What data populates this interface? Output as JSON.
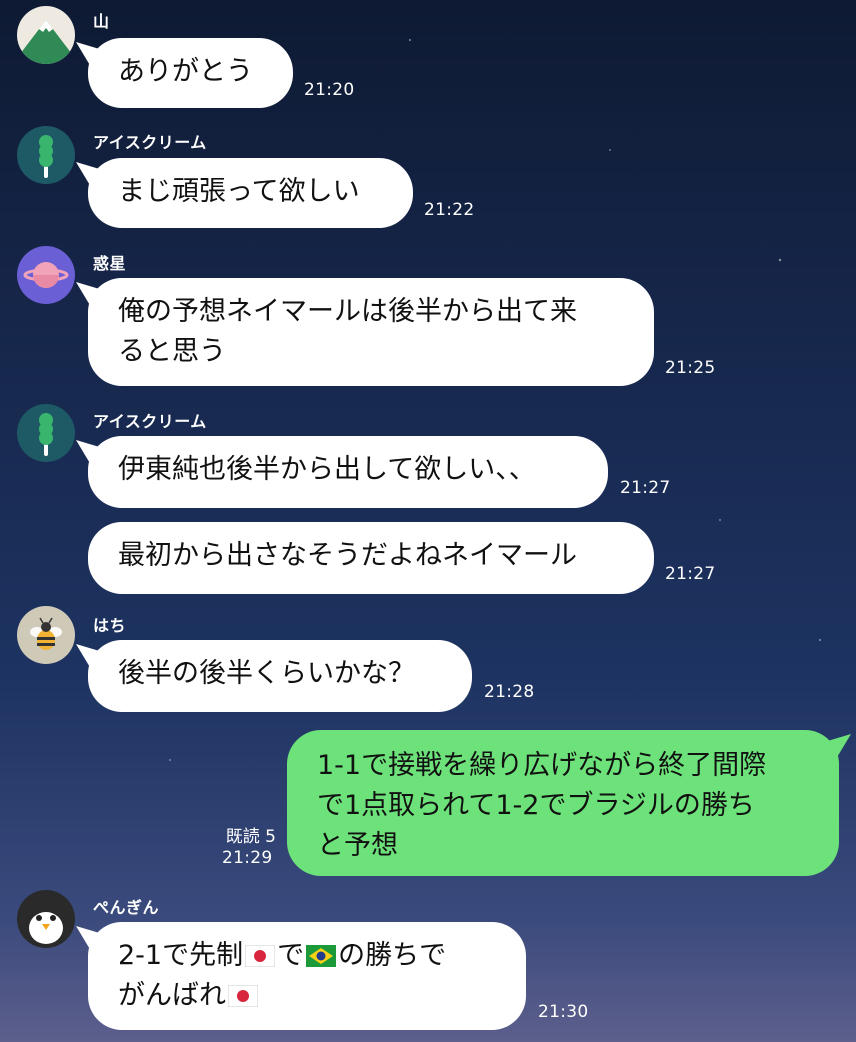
{
  "messages": [
    {
      "sender": "山",
      "text": "ありがとう",
      "time": "21:20"
    },
    {
      "sender": "アイスクリーム",
      "text": "まじ頑張って欲しい",
      "time": "21:22"
    },
    {
      "sender": "惑星",
      "lines": [
        "俺の予想ネイマールは後半から出て来",
        "ると思う"
      ],
      "time": "21:25"
    },
    {
      "sender": "アイスクリーム",
      "text": "伊東純也後半から出して欲しい、、",
      "time": "21:27"
    },
    {
      "text": "最初から出さなそうだよねネイマール",
      "time": "21:27"
    },
    {
      "sender": "はち",
      "text": "後半の後半くらいかな？",
      "time": "21:28"
    },
    {
      "own": true,
      "lines": [
        "1-1で接戦を繰り広げながら終了間際",
        "で1点取られて1-2でブラジルの勝ち",
        "と予想"
      ],
      "read": "既読 5",
      "time": "21:29"
    },
    {
      "sender": "ぺんぎん",
      "parts": {
        "a": "2-1で先制",
        "b": "で",
        "c": "の勝ちで",
        "d": "がんばれ"
      },
      "time": "21:30"
    }
  ],
  "icons": {
    "avatar_yama": "mountain-icon",
    "avatar_ice": "ice-cream-icon",
    "avatar_planet": "planet-icon",
    "avatar_bee": "bee-icon",
    "avatar_penguin": "penguin-icon",
    "flag_japan": "japan-flag-icon",
    "flag_brazil": "brazil-flag-icon"
  },
  "colors": {
    "own_bubble": "#6de27a",
    "other_bubble": "#ffffff"
  }
}
